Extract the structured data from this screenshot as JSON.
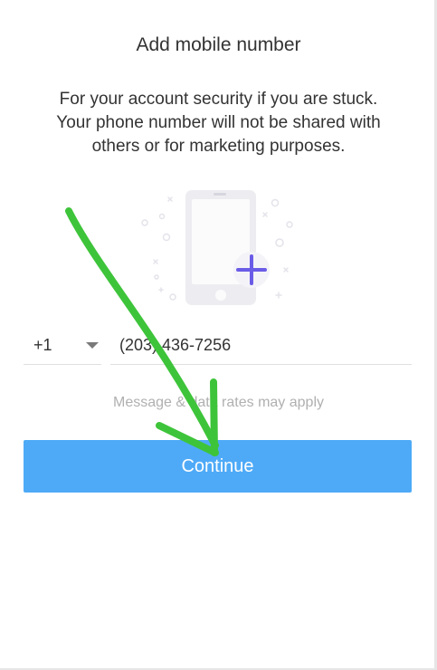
{
  "header": {
    "title": "Add mobile number"
  },
  "description": {
    "line1": "For your account security if you are stuck.",
    "line2": "Your phone number will not be shared with",
    "line3": "others or for marketing purposes."
  },
  "illustration": {
    "icon": "add-phone-icon",
    "accent_color": "#6b5ce7"
  },
  "phone_form": {
    "country_code": "+1",
    "phone_number": "(203) 436-7256"
  },
  "notice": {
    "text": "Message & data rates may apply"
  },
  "actions": {
    "continue_label": "Continue",
    "button_color": "#4eaaf7"
  },
  "annotation": {
    "arrow_color": "#3ec43a"
  }
}
